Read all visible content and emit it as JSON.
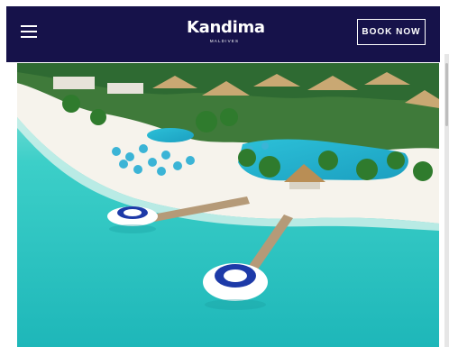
{
  "header": {
    "menu_icon": "hamburger-menu-icon",
    "logo": {
      "name": "Kandima",
      "tagline": "MALDIVES"
    },
    "book_button_label": "BOOK NOW"
  },
  "hero": {
    "alt": "Aerial view of Kandima resort with beach, pool, palm trees and jetties"
  },
  "colors": {
    "header_bg": "#16124a",
    "lagoon": "#2fc7c4",
    "sand": "#f4f1ea",
    "pool": "#27b3d0"
  }
}
